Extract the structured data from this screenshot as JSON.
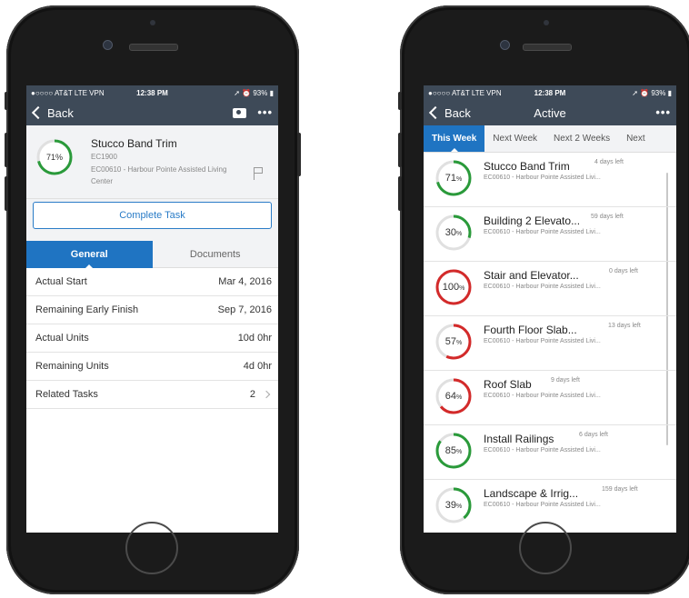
{
  "colors": {
    "statusbar_bg": "#3e4a58",
    "accent_blue": "#1f74c2",
    "ring_green": "#2a9a3a",
    "ring_red": "#d32a2a",
    "ring_track": "#e0e0e0"
  },
  "status": {
    "carrier": "●○○○○ AT&T  LTE  VPN",
    "time": "12:38 PM",
    "battery": "93%"
  },
  "left": {
    "nav": {
      "back_label": "Back",
      "camera_icon": "camera-icon",
      "more_label": "•••"
    },
    "task": {
      "percent": 71,
      "percent_label": "71%",
      "title": "Stucco Band Trim",
      "code": "EC1900",
      "project": "EC00610 - Harbour Pointe Assisted Living Center",
      "flag_icon": "flag-icon"
    },
    "complete_button": "Complete Task",
    "tabs": [
      {
        "label": "General"
      },
      {
        "label": "Documents"
      }
    ],
    "rows": [
      {
        "label": "Actual Start",
        "value": "Mar 4, 2016"
      },
      {
        "label": "Remaining Early Finish",
        "value": "Sep 7, 2016"
      },
      {
        "label": "Actual Units",
        "value": "10d 0hr"
      },
      {
        "label": "Remaining Units",
        "value": "4d 0hr"
      },
      {
        "label": "Related Tasks",
        "value": "2"
      }
    ]
  },
  "right": {
    "nav": {
      "back_label": "Back",
      "title": "Active",
      "more_label": "•••"
    },
    "tabs": [
      {
        "label": "This Week"
      },
      {
        "label": "Next Week"
      },
      {
        "label": "Next 2 Weeks"
      },
      {
        "label": "Next"
      }
    ],
    "tasks": [
      {
        "percent": 71,
        "pct_num": "71",
        "pct_sym": "%",
        "name": "Stucco Band Trim",
        "days": "4 days left",
        "project": "EC00610 - Harbour Pointe Assisted Livi...",
        "color": "#2a9a3a"
      },
      {
        "percent": 30,
        "pct_num": "30",
        "pct_sym": "%",
        "name": "Building 2 Elevato...",
        "days": "59 days left",
        "project": "EC00610 - Harbour Pointe Assisted Livi...",
        "color": "#2a9a3a"
      },
      {
        "percent": 100,
        "pct_num": "100",
        "pct_sym": "%",
        "name": "Stair and Elevator...",
        "days": "0 days left",
        "project": "EC00610 - Harbour Pointe Assisted Livi...",
        "color": "#d32a2a"
      },
      {
        "percent": 57,
        "pct_num": "57",
        "pct_sym": "%",
        "name": "Fourth Floor Slab...",
        "days": "13 days left",
        "project": "EC00610 - Harbour Pointe Assisted Livi...",
        "color": "#d32a2a"
      },
      {
        "percent": 64,
        "pct_num": "64",
        "pct_sym": "%",
        "name": "Roof Slab",
        "days": "9 days left",
        "project": "EC00610 - Harbour Pointe Assisted Livi...",
        "color": "#d32a2a"
      },
      {
        "percent": 85,
        "pct_num": "85",
        "pct_sym": "%",
        "name": "Install Railings",
        "days": "6 days left",
        "project": "EC00610 - Harbour Pointe Assisted Livi...",
        "color": "#2a9a3a"
      },
      {
        "percent": 39,
        "pct_num": "39",
        "pct_sym": "%",
        "name": "Landscape & Irrig...",
        "days": "159 days left",
        "project": "EC00610 - Harbour Pointe Assisted Livi...",
        "color": "#2a9a3a"
      }
    ]
  }
}
